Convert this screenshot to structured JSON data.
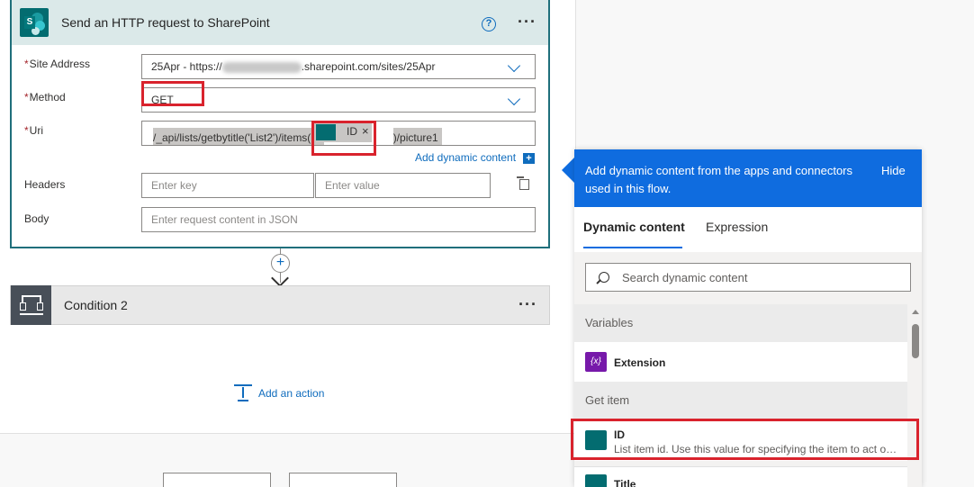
{
  "http_action": {
    "title": "Send an HTTP request to SharePoint",
    "fields": {
      "site_address": {
        "label": "Site Address",
        "value_prefix": "25Apr - https://",
        "value_suffix": ".sharepoint.com/sites/25Apr"
      },
      "method": {
        "label": "Method",
        "value": "GET"
      },
      "uri": {
        "label": "Uri",
        "value_prefix": "/_api/lists/getbytitle('List2')/items(",
        "token_label": "ID",
        "token_remove": "×",
        "value_suffix": ")/picture1"
      },
      "headers": {
        "label": "Headers",
        "key_placeholder": "Enter key",
        "value_placeholder": "Enter value"
      },
      "body": {
        "label": "Body",
        "placeholder": "Enter request content in JSON"
      }
    },
    "required_mark": "*",
    "add_dynamic_content": "Add dynamic content",
    "help_glyph": "?",
    "menu_glyph": "···"
  },
  "condition": {
    "title": "Condition 2",
    "menu_glyph": "···"
  },
  "add_action_label": "Add an action",
  "dynamic_panel": {
    "header_text": "Add dynamic content from the apps and connectors used in this flow.",
    "hide_label": "Hide",
    "tabs": [
      "Dynamic content",
      "Expression"
    ],
    "search_placeholder": "Search dynamic content",
    "sections": [
      {
        "title": "Variables",
        "items": [
          {
            "name": "Extension",
            "icon": "variable-icon",
            "icon_glyph": "{x}"
          }
        ]
      },
      {
        "title": "Get item",
        "items": [
          {
            "name": "ID",
            "description": "List item id. Use this value for specifying the item to act on in other list related actions.",
            "icon": "sharepoint-icon"
          },
          {
            "name": "Title",
            "description": "",
            "icon": "sharepoint-icon"
          }
        ]
      }
    ]
  },
  "colors": {
    "accent": "#0f6cdf",
    "sharepoint": "#036c70",
    "highlight": "#d9232d",
    "variable": "#7719aa"
  }
}
